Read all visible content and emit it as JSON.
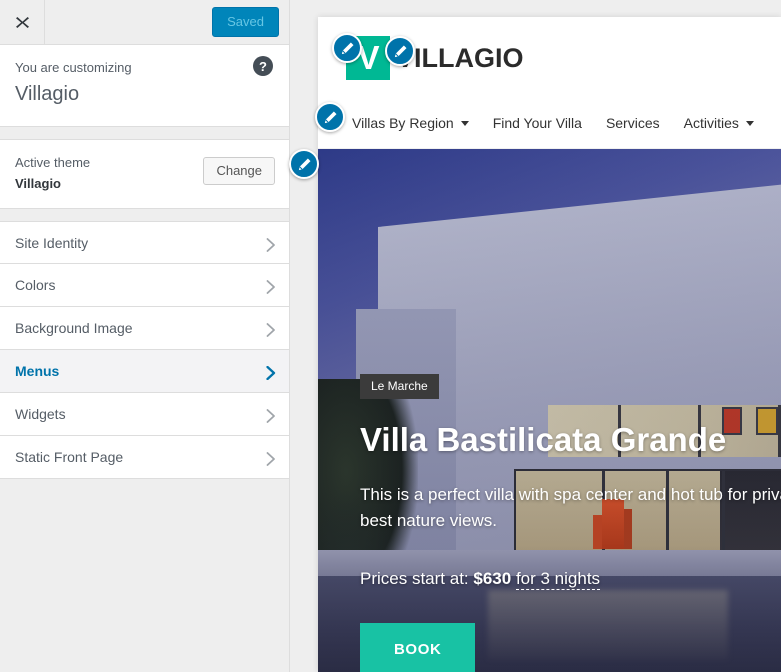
{
  "customizer": {
    "close_label": "×",
    "save_button": "Saved",
    "customizing_label": "You are customizing",
    "customizing_title": "Villagio",
    "help_label": "?",
    "theme_label": "Active theme",
    "theme_name": "Villagio",
    "change_button": "Change",
    "sections": [
      {
        "label": "Site Identity",
        "active": false
      },
      {
        "label": "Colors",
        "active": false
      },
      {
        "label": "Background Image",
        "active": false
      },
      {
        "label": "Menus",
        "active": true
      },
      {
        "label": "Widgets",
        "active": false
      },
      {
        "label": "Static Front Page",
        "active": false
      }
    ],
    "accent_color": "#0073aa",
    "save_color": "#0085ba"
  },
  "preview": {
    "site": {
      "logo_letter": "V",
      "logo_color": "#00b894",
      "site_title": "VILLAGIO",
      "nav": [
        {
          "label": "Villas By Region",
          "has_caret": true
        },
        {
          "label": "Find Your Villa",
          "has_caret": false
        },
        {
          "label": "Services",
          "has_caret": false
        },
        {
          "label": "Activities",
          "has_caret": true
        }
      ]
    },
    "hero": {
      "badge": "Le Marche",
      "title": "Villa Bastilicata Grande",
      "description": "This is a perfect villa with spa center and hot tub for private, f best nature views.",
      "price_prefix": "Prices start at:",
      "price_amount": "$630",
      "price_suffix": "for 3 nights",
      "book_button": "BOOK",
      "book_color": "#18c2a4"
    }
  },
  "edit_pins": {
    "logo": "edit-logo",
    "title": "edit-site-title",
    "nav": "edit-menu",
    "hero": "edit-hero"
  }
}
